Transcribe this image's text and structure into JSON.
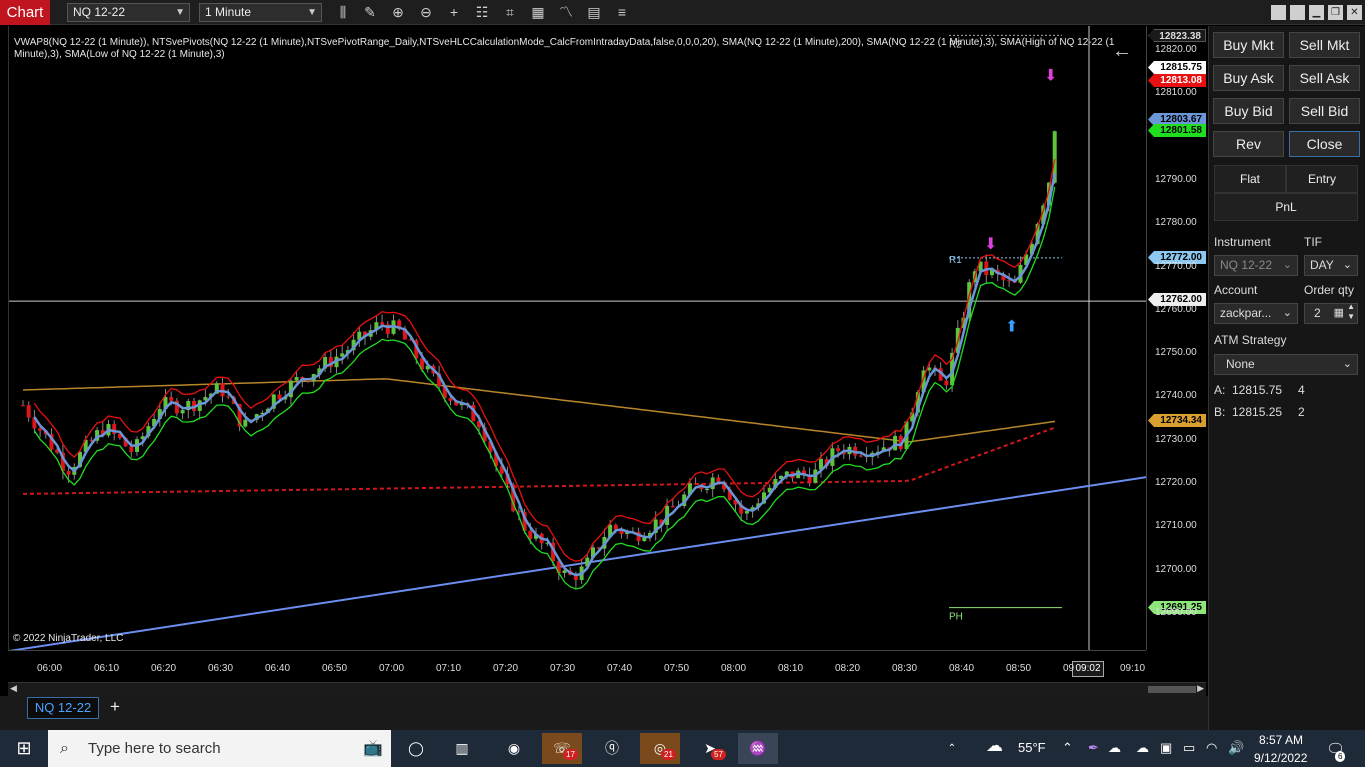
{
  "topbar": {
    "title": "Chart",
    "instrument": "NQ 12-22",
    "interval": "1 Minute",
    "icons": [
      "bars-icon",
      "draw-pencil-icon",
      "zoom-in-icon",
      "zoom-out-icon",
      "crosshair-icon",
      "properties-icon",
      "strategy-icon",
      "indicator-icon",
      "template-icon",
      "menu-icon"
    ]
  },
  "chart": {
    "indicator_text": "VWAP8(NQ 12-22 (1 Minute)), NTSvePivots(NQ 12-22 (1 Minute),NTSvePivotRange_Daily,NTSveHLCCalculationMode_CalcFromIntradayData,false,0,0,0,20), SMA(NQ 12-22 (1 Minute),200), SMA(NQ 12-22 (1 Minute),3), SMA(High of NQ 12-22 (1 Minute),3), SMA(Low of NQ 12-22 (1 Minute),3)",
    "copyright": "© 2022 NinjaTrader, LLC",
    "pivot_r1": "R1",
    "pivot_r2": "R2",
    "pivot_ph": "PH",
    "price_ticks": [
      "12820.00",
      "12810.00",
      "12790.00",
      "12780.00",
      "12770.00",
      "12760.00",
      "12750.00",
      "12740.00",
      "12730.00",
      "12720.00",
      "12710.00",
      "12700.00",
      "12690.00"
    ],
    "price_badges": {
      "r2": "12823.38",
      "last": "12815.75",
      "red": "12813.08",
      "blue": "12803.67",
      "green": "12801.58",
      "r1": "12772.00",
      "crosshair": "12762.00",
      "sma200": "12734.34",
      "ph": "12691.25"
    },
    "time_ticks": [
      "06:00",
      "06:10",
      "06:20",
      "06:30",
      "06:40",
      "06:50",
      "07:00",
      "07:10",
      "07:20",
      "07:30",
      "07:40",
      "07:50",
      "08:00",
      "08:10",
      "08:20",
      "08:30",
      "08:40",
      "08:50",
      "09",
      "09:10"
    ],
    "time_crosshair": "09:02",
    "colors": {
      "up": "#5ec43d",
      "down": "#e0151c",
      "sma3": "#6a96d8",
      "sma_high": "#e81010",
      "sma_low": "#20dd20",
      "sma200": "#b8862a",
      "vwap": "#d01818",
      "trendline": "#6c8ef0"
    }
  },
  "tabs": {
    "active": "NQ 12-22",
    "add": "+"
  },
  "panel": {
    "buy_mkt": "Buy Mkt",
    "sell_mkt": "Sell Mkt",
    "buy_ask": "Buy Ask",
    "sell_ask": "Sell Ask",
    "buy_bid": "Buy Bid",
    "sell_bid": "Sell Bid",
    "rev": "Rev",
    "close": "Close",
    "flat": "Flat",
    "entry": "Entry",
    "pnl": "PnL",
    "instrument_label": "Instrument",
    "instrument_value": "NQ 12-22",
    "tif_label": "TIF",
    "tif_value": "DAY",
    "account_label": "Account",
    "account_value": "zackpar...",
    "order_qty_label": "Order qty",
    "order_qty_value": "2",
    "atm_label": "ATM Strategy",
    "atm_value": "None",
    "ask_label": "A:",
    "ask_price": "12815.75",
    "ask_size": "4",
    "bid_label": "B:",
    "bid_price": "12815.25",
    "bid_size": "2"
  },
  "taskbar": {
    "search_placeholder": "Type here to search",
    "weather": "55°F",
    "time": "8:57 AM",
    "date": "9/12/2022",
    "notifications": "6",
    "badge_whatsapp": "17",
    "badge_chrome": "21",
    "badge_telegram": "57"
  }
}
